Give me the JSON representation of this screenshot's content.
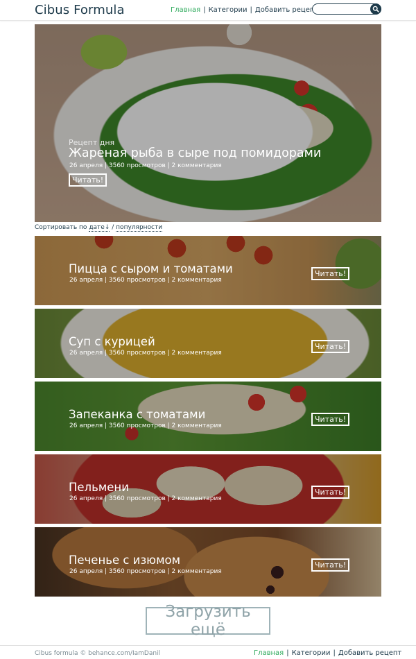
{
  "header": {
    "logo": "Cibus Formula",
    "nav": [
      {
        "label": "Главная",
        "active": true
      },
      {
        "label": "Категории",
        "active": false
      },
      {
        "label": "Добавить рецепт",
        "active": false
      }
    ],
    "search": {
      "value": "",
      "placeholder": ""
    },
    "separator": "|"
  },
  "hero": {
    "label": "Рецепт дня",
    "title": "Жареная рыба в сыре под помидорами",
    "meta": "26 апреля | 3560 просмотров | 2 комментария",
    "read_label": "Читать!"
  },
  "sort": {
    "prefix": "Сортировать по",
    "date": "дате↓",
    "slash": "/",
    "popularity": "популярности"
  },
  "cards": [
    {
      "title": "Пицца с сыром и томатами",
      "meta": "26 апреля | 3560 просмотров | 2 комментария",
      "read_label": "Читать!"
    },
    {
      "title": "Суп с курицей",
      "meta": "26 апреля | 3560 просмотров | 2 комментария",
      "read_label": "Читать!"
    },
    {
      "title": "Запеканка с томатами",
      "meta": "26 апреля | 3560 просмотров | 2 комментария",
      "read_label": "Читать!"
    },
    {
      "title": "Пельмени",
      "meta": "26 апреля | 3560 просмотров | 2 комментария",
      "read_label": "Читать!"
    },
    {
      "title": "Печенье с изюмом",
      "meta": "26 апреля | 3560 просмотров | 2 комментария",
      "read_label": "Читать!"
    }
  ],
  "load_more": "Загрузить ещё",
  "footer": {
    "copyright": "Cibus formula © behance.com/IamDanil",
    "nav": [
      {
        "label": "Главная",
        "active": true
      },
      {
        "label": "Категории",
        "active": false
      },
      {
        "label": "Добавить рецепт",
        "active": false
      }
    ]
  },
  "colors": {
    "accent": "#2eaa5c",
    "text": "#1d3a4a",
    "load_more_border": "#9fb3b8"
  },
  "icons": {
    "search": "search-icon"
  }
}
